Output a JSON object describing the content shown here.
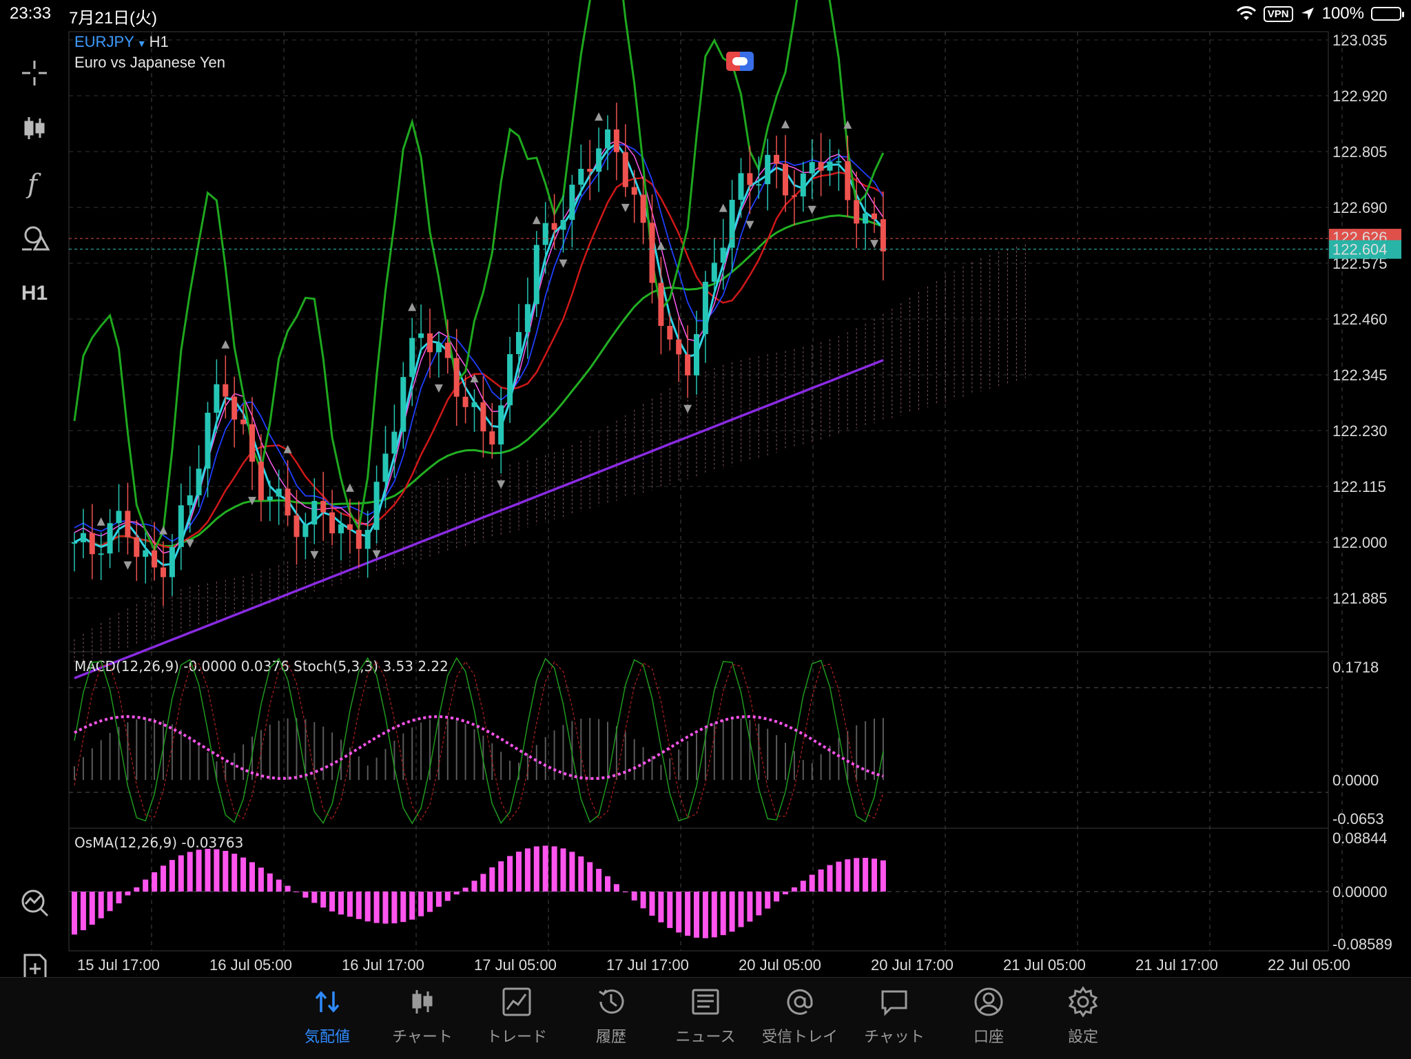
{
  "status_bar": {
    "time": "23:33",
    "date": "7月21日(火)",
    "vpn": "VPN",
    "battery": "100%"
  },
  "symbol": {
    "name": "EURJPY",
    "timeframe": "H1",
    "description": "Euro vs Japanese Yen"
  },
  "toolbar": {
    "timeframe_button": "H1"
  },
  "price_axis": {
    "labels": [
      "123.035",
      "122.920",
      "122.805",
      "122.690",
      "122.575",
      "122.460",
      "122.345",
      "122.230",
      "122.115",
      "122.000",
      "121.885"
    ],
    "bid_marker": "122.626",
    "ask_marker": "122.604"
  },
  "macd_panel": {
    "label": "MACD(12,26,9) -0.0000 0.0376 Stoch(5,3,3) 3.53 2.22",
    "axis_labels": [
      "0.1718",
      "0.0000",
      "-0.0653"
    ]
  },
  "osma_panel": {
    "label": "OsMA(12,26,9) -0.03763",
    "axis_labels": [
      "0.08844",
      "0.00000",
      "-0.08589"
    ]
  },
  "time_axis": {
    "labels": [
      "15 Jul 17:00",
      "16 Jul 05:00",
      "16 Jul 17:00",
      "17 Jul 05:00",
      "17 Jul 17:00",
      "20 Jul 05:00",
      "20 Jul 17:00",
      "21 Jul 05:00",
      "21 Jul 17:00",
      "22 Jul 05:00"
    ]
  },
  "colors": {
    "bull": "#26c6b6",
    "bear": "#ef5350",
    "ma_fast": "#30d5e6",
    "ma_red": "#d01818",
    "ma_green": "#22b022",
    "ma_purple": "#8a2be2",
    "ma_blue": "#1f3fff",
    "pink": "#ff5cf0",
    "osma": "#ff55ee",
    "accent": "#2f8bff"
  },
  "nav": [
    {
      "label": "気配値",
      "icon": "quotes-icon"
    },
    {
      "label": "チャート",
      "icon": "chart-candles-icon"
    },
    {
      "label": "トレード",
      "icon": "trade-icon"
    },
    {
      "label": "履歴",
      "icon": "history-icon"
    },
    {
      "label": "ニュース",
      "icon": "news-icon"
    },
    {
      "label": "受信トレイ",
      "icon": "inbox-icon"
    },
    {
      "label": "チャット",
      "icon": "chat-icon"
    },
    {
      "label": "口座",
      "icon": "account-icon"
    },
    {
      "label": "設定",
      "icon": "settings-icon"
    }
  ]
}
